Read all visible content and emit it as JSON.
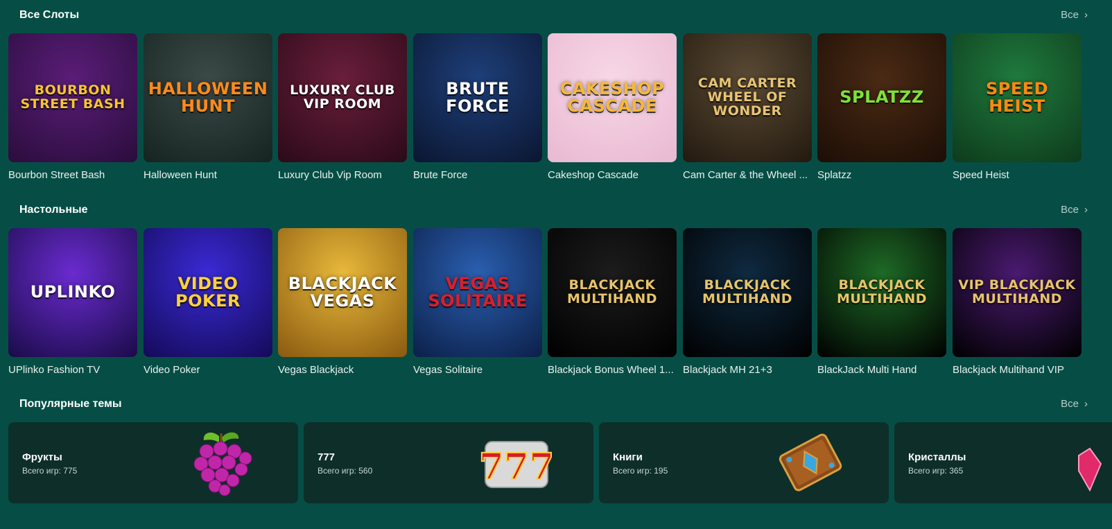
{
  "sections": {
    "slots": {
      "title": "Все Слоты",
      "see_all": "Все",
      "games": [
        {
          "title": "Bourbon Street Bash",
          "art": "Bourbon Street Bash",
          "bg": [
            "#5a1d78",
            "#2a0d3c"
          ],
          "fg": "#f7c431"
        },
        {
          "title": "Halloween Hunt",
          "art": "Halloween Hunt",
          "bg": [
            "#3b4a47",
            "#152420"
          ],
          "fg": "#ff8a1c"
        },
        {
          "title": "Luxury Club Vip Room",
          "art": "Luxury Club VIP Room",
          "bg": [
            "#6a1e3a",
            "#2b0a18"
          ],
          "fg": "#ffffff"
        },
        {
          "title": "Brute Force",
          "art": "Brute Force",
          "bg": [
            "#1e3f7a",
            "#0b1630"
          ],
          "fg": "#ffffff"
        },
        {
          "title": "Cakeshop Cascade",
          "art": "Cakeshop Cascade",
          "bg": [
            "#f7d7e6",
            "#e9b9d2"
          ],
          "fg": "#f5b93a"
        },
        {
          "title": "Cam Carter & the Wheel ...",
          "art": "Cam Carter Wheel of Wonder",
          "bg": [
            "#5a4a34",
            "#22190f"
          ],
          "fg": "#e8c575"
        },
        {
          "title": "Splatzz",
          "art": "Splatzz",
          "bg": [
            "#4a2a14",
            "#1c0e06"
          ],
          "fg": "#7ee23a"
        },
        {
          "title": "Speed Heist",
          "art": "Speed Heist",
          "bg": [
            "#1f7a3d",
            "#0e3a1c"
          ],
          "fg": "#ff8a10"
        }
      ]
    },
    "table": {
      "title": "Настольные",
      "see_all": "Все",
      "games": [
        {
          "title": "UPlinko Fashion TV",
          "art": "Uplinko",
          "bg": [
            "#6a2bd0",
            "#1a0b48"
          ],
          "fg": "#ffffff"
        },
        {
          "title": "Video Poker",
          "art": "Video Poker",
          "bg": [
            "#3a2ad6",
            "#140a58"
          ],
          "fg": "#ffd13a"
        },
        {
          "title": "Vegas Blackjack",
          "art": "BlackJack Vegas",
          "bg": [
            "#e8b93a",
            "#8a5a10"
          ],
          "fg": "#ffffff"
        },
        {
          "title": "Vegas Solitaire",
          "art": "Vegas Solitaire",
          "bg": [
            "#2a5fb0",
            "#0c1f48"
          ],
          "fg": "#d8202c"
        },
        {
          "title": "Blackjack Bonus Wheel 1...",
          "art": "Blackjack Multihand",
          "bg": [
            "#1c1c1c",
            "#000000"
          ],
          "fg": "#e7c46a"
        },
        {
          "title": "Blackjack MH 21+3",
          "art": "Blackjack Multihand",
          "bg": [
            "#0f2a40",
            "#000000"
          ],
          "fg": "#e7c46a"
        },
        {
          "title": "BlackJack Multi Hand",
          "art": "Blackjack Multihand",
          "bg": [
            "#1e6a26",
            "#000000"
          ],
          "fg": "#e7c46a"
        },
        {
          "title": "Blackjack Multihand VIP",
          "art": "VIP Blackjack Multihand",
          "bg": [
            "#4a1a70",
            "#000000"
          ],
          "fg": "#e7c46a"
        }
      ]
    },
    "themes": {
      "title": "Популярные темы",
      "see_all": "Все",
      "items": [
        {
          "name": "Фрукты",
          "count": "Всего игр: 775",
          "icon": "grapes-icon"
        },
        {
          "name": "777",
          "count": "Всего игр: 560",
          "icon": "seven-icon"
        },
        {
          "name": "Книги",
          "count": "Всего игр: 195",
          "icon": "book-icon"
        },
        {
          "name": "Кристаллы",
          "count": "Всего игр: 365",
          "icon": "crystal-icon"
        }
      ]
    }
  },
  "colors": {
    "background": "#064e45",
    "theme_card": "#0e2e2a",
    "muted_text": "#b9cfcb"
  }
}
